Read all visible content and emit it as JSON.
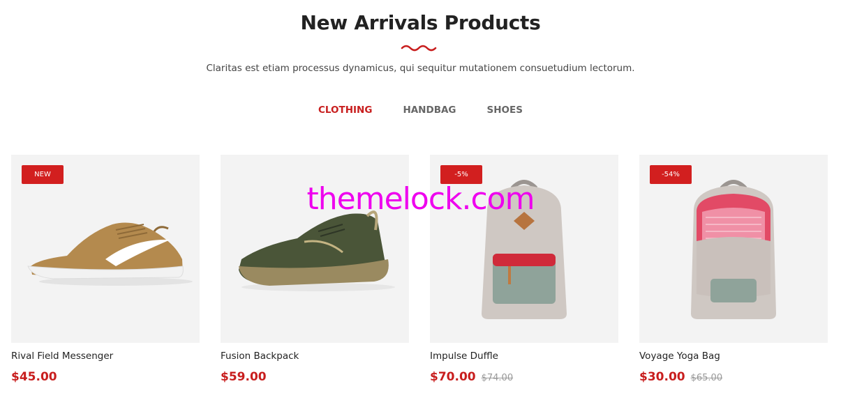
{
  "section": {
    "title": "New Arrivals Products",
    "subtitle": "Claritas est etiam processus dynamicus, qui sequitur mutationem consuetudium lectorum."
  },
  "tabs": [
    {
      "label": "CLOTHING",
      "active": true
    },
    {
      "label": "HANDBAG",
      "active": false
    },
    {
      "label": "SHOES",
      "active": false
    }
  ],
  "products": [
    {
      "name": "Rival Field Messenger",
      "price": "$45.00",
      "old_price": "",
      "badge": "NEW",
      "image": "brown-sneaker-image"
    },
    {
      "name": "Fusion Backpack",
      "price": "$59.00",
      "old_price": "",
      "badge": "",
      "image": "olive-running-shoe-image"
    },
    {
      "name": "Impulse Duffle",
      "price": "$70.00",
      "old_price": "$74.00",
      "badge": "-5%",
      "image": "grey-backpack-image"
    },
    {
      "name": "Voyage Yoga Bag",
      "price": "$30.00",
      "old_price": "$65.00",
      "badge": "-54%",
      "image": "open-backpack-image"
    }
  ],
  "watermark": "themelock.com",
  "colors": {
    "accent": "#c81e1e",
    "badge": "#d21f1f",
    "image_bg": "#f3f3f3",
    "watermark": "#ee00ee"
  }
}
